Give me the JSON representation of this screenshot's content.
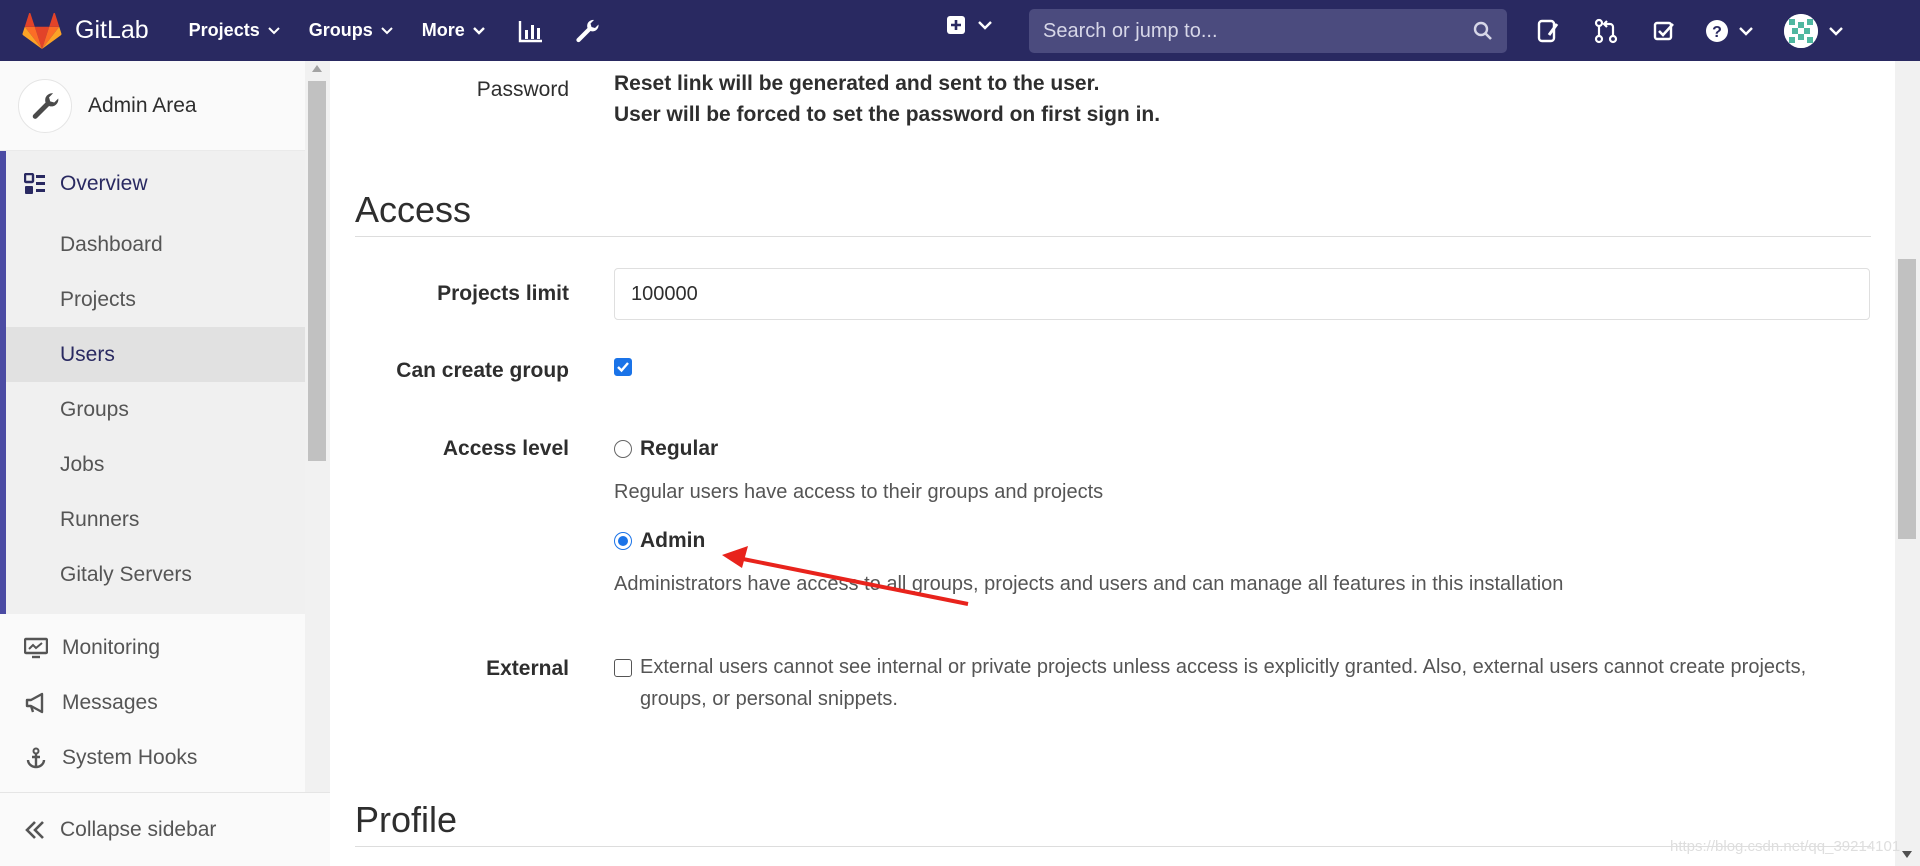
{
  "navbar": {
    "brand": "GitLab",
    "menu": [
      {
        "label": "Projects"
      },
      {
        "label": "Groups"
      },
      {
        "label": "More"
      }
    ],
    "search_placeholder": "Search or jump to..."
  },
  "sidebar": {
    "title": "Admin Area",
    "overview_label": "Overview",
    "sub_items": [
      {
        "label": "Dashboard"
      },
      {
        "label": "Projects"
      },
      {
        "label": "Users"
      },
      {
        "label": "Groups"
      },
      {
        "label": "Jobs"
      },
      {
        "label": "Runners"
      },
      {
        "label": "Gitaly Servers"
      }
    ],
    "items": [
      {
        "label": "Monitoring",
        "icon": "monitor-icon"
      },
      {
        "label": "Messages",
        "icon": "megaphone-icon"
      },
      {
        "label": "System Hooks",
        "icon": "anchor-icon"
      }
    ],
    "collapse_label": "Collapse sidebar"
  },
  "password": {
    "label": "Password",
    "line1": "Reset link will be generated and sent to the user.",
    "line2": "User will be forced to set the password on first sign in."
  },
  "access": {
    "title": "Access",
    "projects_limit_label": "Projects limit",
    "projects_limit_value": "100000",
    "can_create_group_label": "Can create group",
    "can_create_group_checked": true,
    "access_level_label": "Access level",
    "regular_label": "Regular",
    "regular_help": "Regular users have access to their groups and projects",
    "admin_label": "Admin",
    "admin_help": "Administrators have access to all groups, projects and users and can manage all features in this installation",
    "selected": "Admin",
    "external_label": "External",
    "external_text": "External users cannot see internal or private projects unless access is explicitly granted. Also, external users cannot create projects, groups, or personal snippets.",
    "external_checked": false
  },
  "profile": {
    "title": "Profile"
  },
  "annotation": {
    "arrow_color": "#e8231c"
  },
  "watermark": "https://blog.csdn.net/qq_39214101",
  "colors": {
    "navbar": "#292961",
    "accent": "#1a73e8",
    "sidebar_active_border": "#4b4ba3"
  }
}
